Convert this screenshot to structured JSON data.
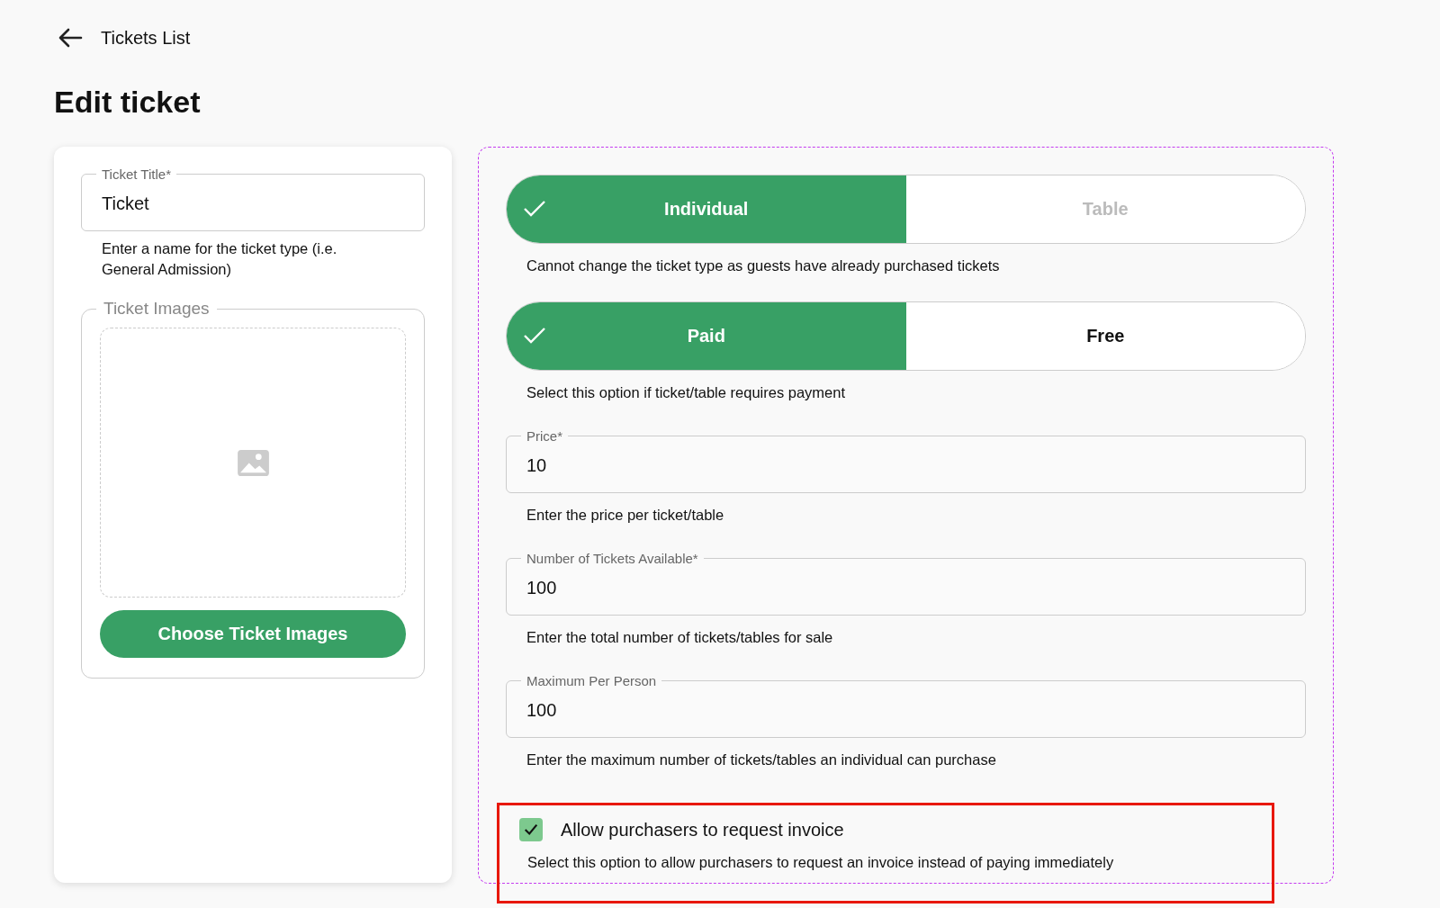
{
  "back_link": {
    "label": "Tickets List"
  },
  "page_title": "Edit ticket",
  "ticket_title_field": {
    "label": "Ticket Title*",
    "value": "Ticket",
    "helper": "Enter a name for the ticket type (i.e. General Admission)"
  },
  "ticket_images": {
    "label": "Ticket Images",
    "button": "Choose Ticket Images"
  },
  "toggle_groups": [
    {
      "options": [
        {
          "label": "Individual",
          "selected": true,
          "disabled": false
        },
        {
          "label": "Table",
          "selected": false,
          "disabled": true
        }
      ],
      "helper": "Cannot change the ticket type as guests have already purchased tickets"
    },
    {
      "options": [
        {
          "label": "Paid",
          "selected": true,
          "disabled": false
        },
        {
          "label": "Free",
          "selected": false,
          "disabled": false
        }
      ],
      "helper": "Select this option if ticket/table requires payment"
    }
  ],
  "fields": [
    {
      "label": "Price*",
      "value": "10",
      "helper": "Enter the price per ticket/table"
    },
    {
      "label": "Number of Tickets Available*",
      "value": "100",
      "helper": "Enter the total number of tickets/tables for sale"
    },
    {
      "label": "Maximum Per Person",
      "value": "100",
      "helper": "Enter the maximum number of tickets/tables an individual can purchase"
    }
  ],
  "invoice_option": {
    "label": "Allow purchasers to request invoice",
    "checked": true,
    "helper": "Select this option to allow purchasers to request an invoice instead of paying immediately"
  }
}
